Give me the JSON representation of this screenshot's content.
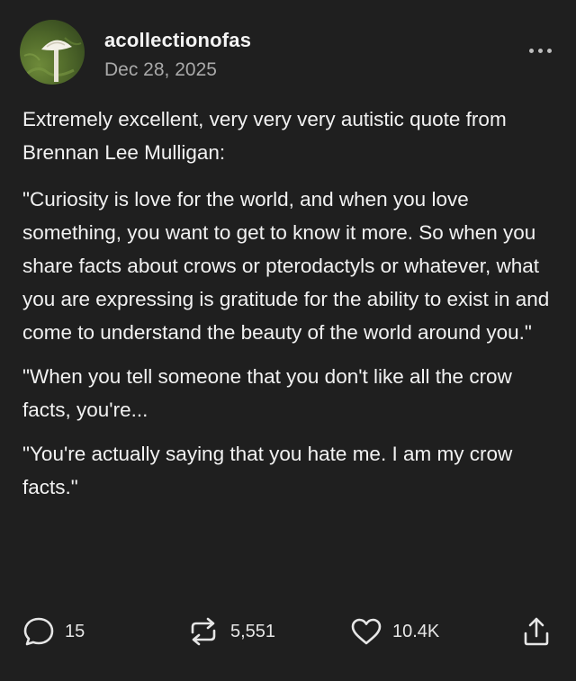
{
  "post": {
    "username": "acollectionofas",
    "date": "Dec 28, 2025",
    "paragraphs": [
      "Extremely excellent, very very very autistic quote from Brennan Lee Mulligan:",
      "\"Curiosity is love for the world, and when you love something, you want to get to know it more. So when you share facts about crows or pterodactyls or whatever, what you are expressing is gratitude for the ability to exist in and come to understand the beauty of the world around you.\"",
      "\"When you tell someone that you don't like all the crow facts, you're...",
      "\"You're actually saying that you hate me. I am my crow facts.\""
    ]
  },
  "actions": {
    "replies": "15",
    "reblogs": "5,551",
    "likes": "10.4K"
  },
  "icons": {
    "reply": "speech-bubble-icon",
    "reblog": "reblog-arrows-icon",
    "like": "heart-icon",
    "share": "share-upload-icon",
    "more": "ellipsis-icon"
  },
  "colors": {
    "background": "#1f1f1f",
    "text": "#f2f2f2",
    "muted": "#a9a9a9"
  }
}
